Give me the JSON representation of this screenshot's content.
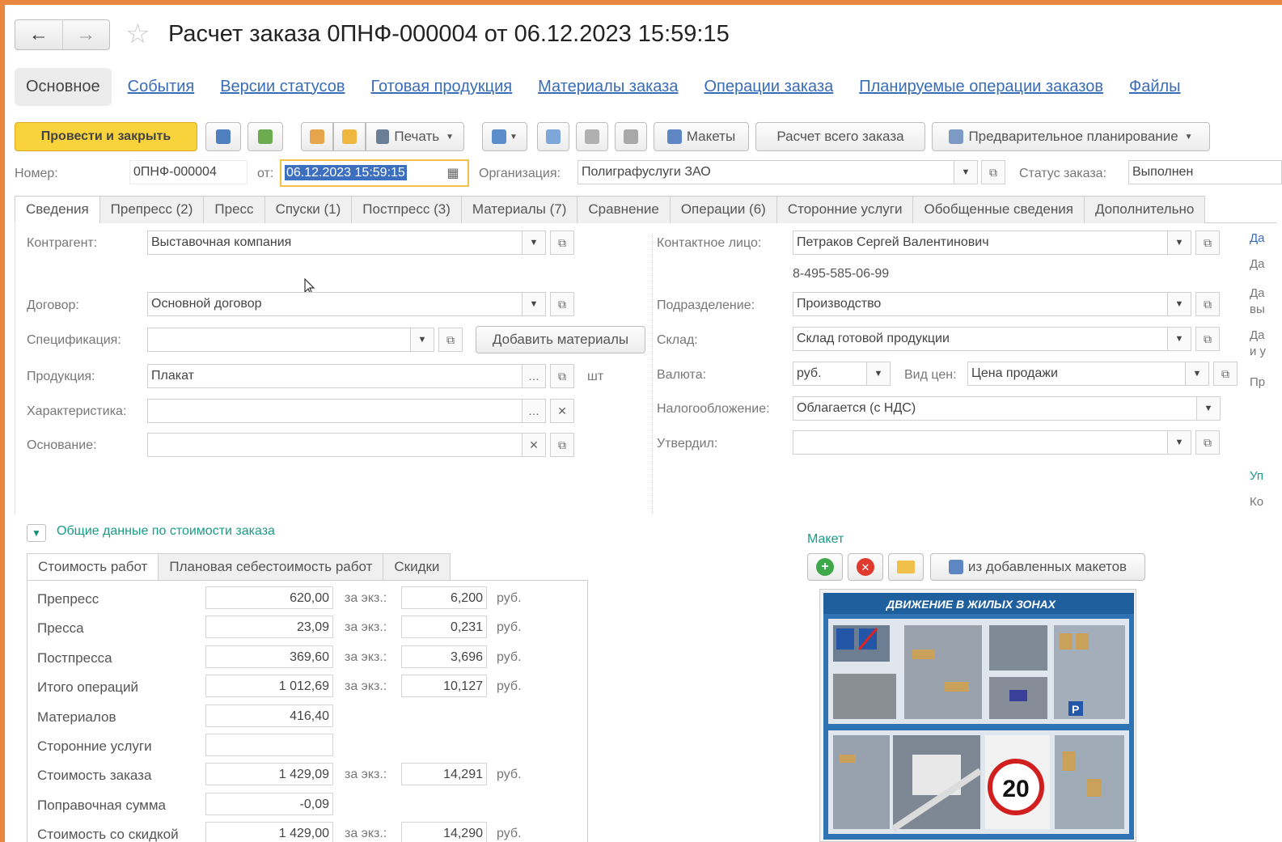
{
  "window": {
    "title": "Расчет заказа 0ПНФ-000004 от 06.12.2023 15:59:15",
    "back_icon": "←",
    "forward_icon": "→"
  },
  "section_tabs": [
    {
      "label": "Основное",
      "active": true
    },
    {
      "label": "События"
    },
    {
      "label": "Версии статусов"
    },
    {
      "label": "Готовая продукция"
    },
    {
      "label": "Материалы заказа"
    },
    {
      "label": "Операции заказа"
    },
    {
      "label": "Планируемые операции заказов"
    },
    {
      "label": "Файлы"
    }
  ],
  "toolbar": {
    "post_close": "Провести и закрыть",
    "print": "Печать",
    "layouts": "Макеты",
    "calc_all": "Расчет всего заказа",
    "prelim_planning": "Предварительное планирование"
  },
  "header": {
    "number_label": "Номер:",
    "number_value": "0ПНФ-000004",
    "from_label": "от:",
    "date_value": "06.12.2023 15:59:15",
    "org_label": "Организация:",
    "org_value": "Полиграфуслуги ЗАО",
    "status_label": "Статус заказа:",
    "status_value": "Выполнен"
  },
  "form_tabs": [
    {
      "label": "Сведения",
      "active": true
    },
    {
      "label": "Препресс (2)"
    },
    {
      "label": "Пресс"
    },
    {
      "label": "Спуски (1)"
    },
    {
      "label": "Постпресс (3)"
    },
    {
      "label": "Материалы (7)"
    },
    {
      "label": "Сравнение"
    },
    {
      "label": "Операции (6)"
    },
    {
      "label": "Сторонние услуги"
    },
    {
      "label": "Обобщенные сведения"
    },
    {
      "label": "Дополнительно"
    }
  ],
  "left_fields": {
    "counterparty_label": "Контрагент:",
    "counterparty_value": "Выставочная компания",
    "contract_label": "Договор:",
    "contract_value": "Основной договор",
    "spec_label": "Спецификация:",
    "spec_value": "",
    "add_materials": "Добавить материалы",
    "product_label": "Продукция:",
    "product_value": "Плакат",
    "product_unit": "шт",
    "characteristic_label": "Характеристика:",
    "characteristic_value": "",
    "basis_label": "Основание:",
    "basis_value": ""
  },
  "right_fields": {
    "contact_label": "Контактное лицо:",
    "contact_value": "Петраков Сергей Валентинович",
    "phone": "8-495-585-06-99",
    "division_label": "Подразделение:",
    "division_value": "Производство",
    "warehouse_label": "Склад:",
    "warehouse_value": "Склад готовой продукции",
    "currency_label": "Валюта:",
    "currency_value": "руб.",
    "price_type_label": "Вид цен:",
    "price_type_value": "Цена продажи",
    "tax_label": "Налогообложение:",
    "tax_value": "Облагается (с НДС)",
    "approved_label": "Утвердил:",
    "approved_value": ""
  },
  "right_edge": {
    "items": [
      "Да",
      "Да",
      "Да",
      "вы",
      "Да",
      "и у",
      "Пр",
      "Уп",
      "Ко"
    ]
  },
  "cost": {
    "group_title": "Общие данные по стоимости заказа",
    "tabs": [
      {
        "label": "Стоимость работ",
        "active": true
      },
      {
        "label": "Плановая себестоимость работ"
      },
      {
        "label": "Скидки"
      }
    ],
    "per_label": "за экз.:",
    "unit": "руб.",
    "rows": [
      {
        "label": "Препресс",
        "value": "620,00",
        "per": "6,200"
      },
      {
        "label": "Пресса",
        "value": "23,09",
        "per": "0,231"
      },
      {
        "label": "Постпресса",
        "value": "369,60",
        "per": "3,696"
      },
      {
        "label": "Итого операций",
        "value": "1 012,69",
        "per": "10,127"
      },
      {
        "label": "Материалов",
        "value": "416,40",
        "per": ""
      },
      {
        "label": "Сторонние услуги",
        "value": "",
        "per": ""
      },
      {
        "label": "Стоимость заказа",
        "value": "1 429,09",
        "per": "14,291"
      },
      {
        "label": "Поправочная сумма",
        "value": "-0,09",
        "per": ""
      },
      {
        "label": "Стоимость со скидкой",
        "value": "1 429,00",
        "per": "14,290"
      }
    ]
  },
  "maket": {
    "label": "Макет",
    "from_added": "из добавленных макетов",
    "poster_title": "ДВИЖЕНИЕ В ЖИЛЫХ ЗОНАХ",
    "speed_sign": "20",
    "parking_sign": "P"
  }
}
